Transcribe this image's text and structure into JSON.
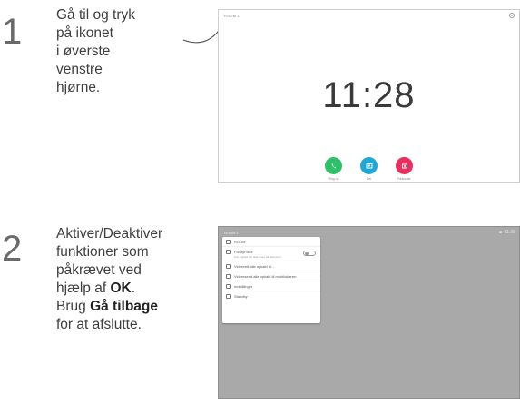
{
  "step1": {
    "number": "1",
    "line1": "Gå til og tryk",
    "line2": "på ikonet",
    "line3": "i øverste",
    "line4": "venstre",
    "line5": "hjørne."
  },
  "step2": {
    "number": "2",
    "line1": "Aktiver/Deaktiver",
    "line2": "funktioner som",
    "line3": "påkrævet ved",
    "line4_pre": "hjælp af ",
    "line4_bold": "OK",
    "line4_post": ".",
    "line5_pre": "Brug ",
    "line5_bold": "Gå tilbage",
    "line6": "for at afslutte."
  },
  "screen1": {
    "topleft_text": "ROOM 1",
    "settings_icon": "gear-icon",
    "time": "11:28",
    "buttons": [
      {
        "icon": "call-icon",
        "label": "Ring op",
        "color": "#2fc06a"
      },
      {
        "icon": "share-icon",
        "label": "Del",
        "color": "#1fa7d6"
      },
      {
        "icon": "record-icon",
        "label": "Rekorder",
        "color": "#ea2f5f"
      }
    ]
  },
  "screen2": {
    "topleft_text": "ROOM 1",
    "topright_text": "11:28",
    "background": "#a9a9a9",
    "menu": [
      {
        "icon": "location-icon",
        "label": "ROOM"
      },
      {
        "icon": "do-not-disturb-icon",
        "label": "Forstyr ikke",
        "sub": "Kun opkald der skal vises på skærmen"
      },
      {
        "icon": "phone-icon",
        "label": "Viderestil alle opkald til..."
      },
      {
        "icon": "monitor-icon",
        "label": "Videresend alle opkald til mobil/skærm"
      },
      {
        "icon": "settings-icon",
        "label": "Indstillinger"
      },
      {
        "icon": "standby-icon",
        "label": "Standby"
      }
    ]
  }
}
